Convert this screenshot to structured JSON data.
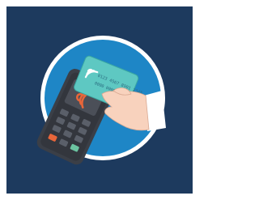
{
  "illustration": {
    "subject": "contactless-card-payment",
    "icons": [
      "contactless-icon",
      "payment-terminal",
      "credit-card",
      "hand"
    ],
    "card": {
      "number": "0123 4567 8901 2345",
      "line2": "0000 0000"
    },
    "colors": {
      "background": "#1d3a5e",
      "circle_outer": "#ffffff",
      "circle_inner": "#1e86c6",
      "terminal_body": "#3b3f47",
      "terminal_screen": "#4b4f58",
      "card": "#5ec8c2",
      "hand": "#f8d2bd",
      "sleeve": "#ffffff",
      "accent": "#e8663a"
    }
  }
}
